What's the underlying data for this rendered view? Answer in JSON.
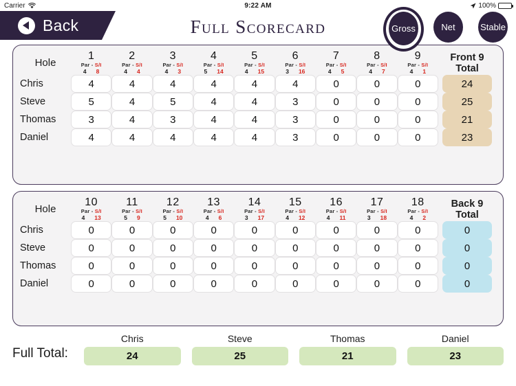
{
  "status_bar": {
    "carrier": "Carrier",
    "wifi_icon": "wifi-icon",
    "time": "9:22 AM",
    "location_icon": "location-arrow-icon",
    "battery_percent": "100%"
  },
  "nav": {
    "back_label": "Back",
    "back_icon": "chevron-left-circle-icon",
    "title": "Full Scorecard",
    "modes": [
      {
        "label": "Gross",
        "selected": true
      },
      {
        "label": "Net",
        "selected": false
      },
      {
        "label": "Stable",
        "selected": false
      }
    ]
  },
  "labels": {
    "hole": "Hole",
    "par": "Par",
    "dash": "-",
    "si": "S/I",
    "front_total": "Front 9\nTotal",
    "front_total_line1": "Front 9",
    "front_total_line2": "Total",
    "back_total_line1": "Back 9",
    "back_total_line2": "Total",
    "full_total": "Full Total:"
  },
  "colors": {
    "nav_purple": "#2e2240",
    "card_border": "#4a3b5c",
    "card_bg": "#f4f3f4",
    "front_total_bg": "#e8d5b5",
    "back_total_bg": "#bfe4ef",
    "full_total_bg": "#d5e8bd",
    "si_red": "#d7261e"
  },
  "players": [
    "Chris",
    "Steve",
    "Thomas",
    "Daniel"
  ],
  "front9": {
    "holes": [
      {
        "number": "1",
        "par": "4",
        "si": "8"
      },
      {
        "number": "2",
        "par": "4",
        "si": "4"
      },
      {
        "number": "3",
        "par": "4",
        "si": "3"
      },
      {
        "number": "4",
        "par": "5",
        "si": "14"
      },
      {
        "number": "5",
        "par": "4",
        "si": "15"
      },
      {
        "number": "6",
        "par": "3",
        "si": "16"
      },
      {
        "number": "7",
        "par": "4",
        "si": "5"
      },
      {
        "number": "8",
        "par": "4",
        "si": "7"
      },
      {
        "number": "9",
        "par": "4",
        "si": "1"
      }
    ],
    "rows": [
      {
        "player": "Chris",
        "scores": [
          "4",
          "4",
          "4",
          "4",
          "4",
          "4",
          "0",
          "0",
          "0"
        ],
        "total": "24"
      },
      {
        "player": "Steve",
        "scores": [
          "5",
          "4",
          "5",
          "4",
          "4",
          "3",
          "0",
          "0",
          "0"
        ],
        "total": "25"
      },
      {
        "player": "Thomas",
        "scores": [
          "3",
          "4",
          "3",
          "4",
          "4",
          "3",
          "0",
          "0",
          "0"
        ],
        "total": "21"
      },
      {
        "player": "Daniel",
        "scores": [
          "4",
          "4",
          "4",
          "4",
          "4",
          "3",
          "0",
          "0",
          "0"
        ],
        "total": "23"
      }
    ]
  },
  "back9": {
    "holes": [
      {
        "number": "10",
        "par": "4",
        "si": "13"
      },
      {
        "number": "11",
        "par": "5",
        "si": "9"
      },
      {
        "number": "12",
        "par": "5",
        "si": "10"
      },
      {
        "number": "13",
        "par": "4",
        "si": "6"
      },
      {
        "number": "14",
        "par": "3",
        "si": "17"
      },
      {
        "number": "15",
        "par": "4",
        "si": "12"
      },
      {
        "number": "16",
        "par": "4",
        "si": "11"
      },
      {
        "number": "17",
        "par": "3",
        "si": "18"
      },
      {
        "number": "18",
        "par": "4",
        "si": "2"
      }
    ],
    "rows": [
      {
        "player": "Chris",
        "scores": [
          "0",
          "0",
          "0",
          "0",
          "0",
          "0",
          "0",
          "0",
          "0"
        ],
        "total": "0"
      },
      {
        "player": "Steve",
        "scores": [
          "0",
          "0",
          "0",
          "0",
          "0",
          "0",
          "0",
          "0",
          "0"
        ],
        "total": "0"
      },
      {
        "player": "Thomas",
        "scores": [
          "0",
          "0",
          "0",
          "0",
          "0",
          "0",
          "0",
          "0",
          "0"
        ],
        "total": "0"
      },
      {
        "player": "Daniel",
        "scores": [
          "0",
          "0",
          "0",
          "0",
          "0",
          "0",
          "0",
          "0",
          "0"
        ],
        "total": "0"
      }
    ]
  },
  "full_totals": [
    {
      "player": "Chris",
      "total": "24"
    },
    {
      "player": "Steve",
      "total": "25"
    },
    {
      "player": "Thomas",
      "total": "21"
    },
    {
      "player": "Daniel",
      "total": "23"
    }
  ]
}
